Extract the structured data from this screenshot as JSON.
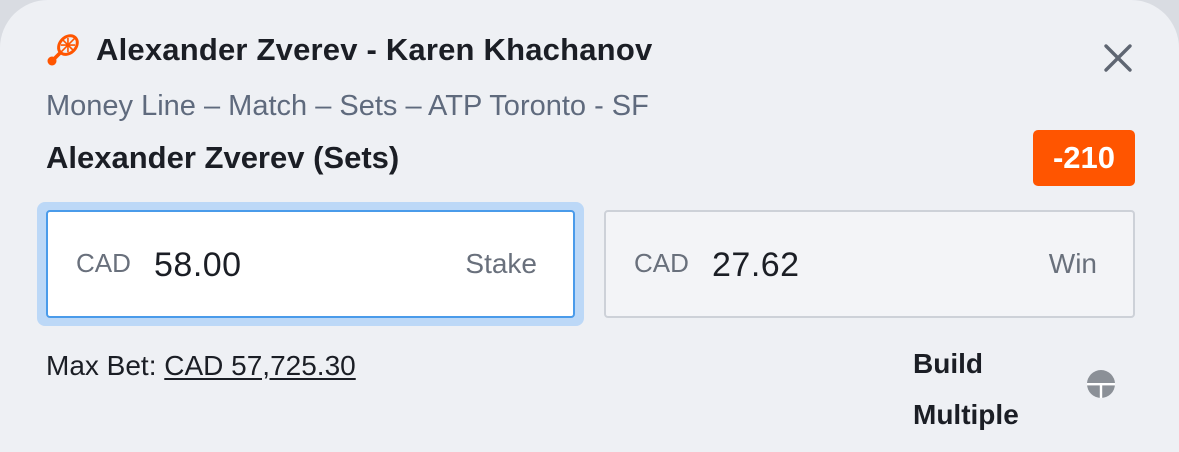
{
  "event": {
    "title": "Alexander Zverev - Karen Khachanov",
    "sport_icon": "tennis-racket-icon"
  },
  "market": {
    "description": "Money Line – Match – Sets – ATP Toronto - SF"
  },
  "selection": {
    "name": "Alexander Zverev (Sets)",
    "odds": "-210"
  },
  "stake": {
    "currency": "CAD",
    "value": "58.00",
    "label": "Stake"
  },
  "win": {
    "currency": "CAD",
    "value": "27.62",
    "label": "Win"
  },
  "max_bet": {
    "label": "Max Bet:",
    "value": "CAD 57,725.30"
  },
  "build_multiple": {
    "line1": "Build",
    "line2": "Multiple"
  },
  "colors": {
    "accent": "#ff5500",
    "focus": "#4a9bea",
    "background": "#eef0f4"
  },
  "icons": {
    "close": "close-icon",
    "build_multiple": "toggle-icon"
  }
}
